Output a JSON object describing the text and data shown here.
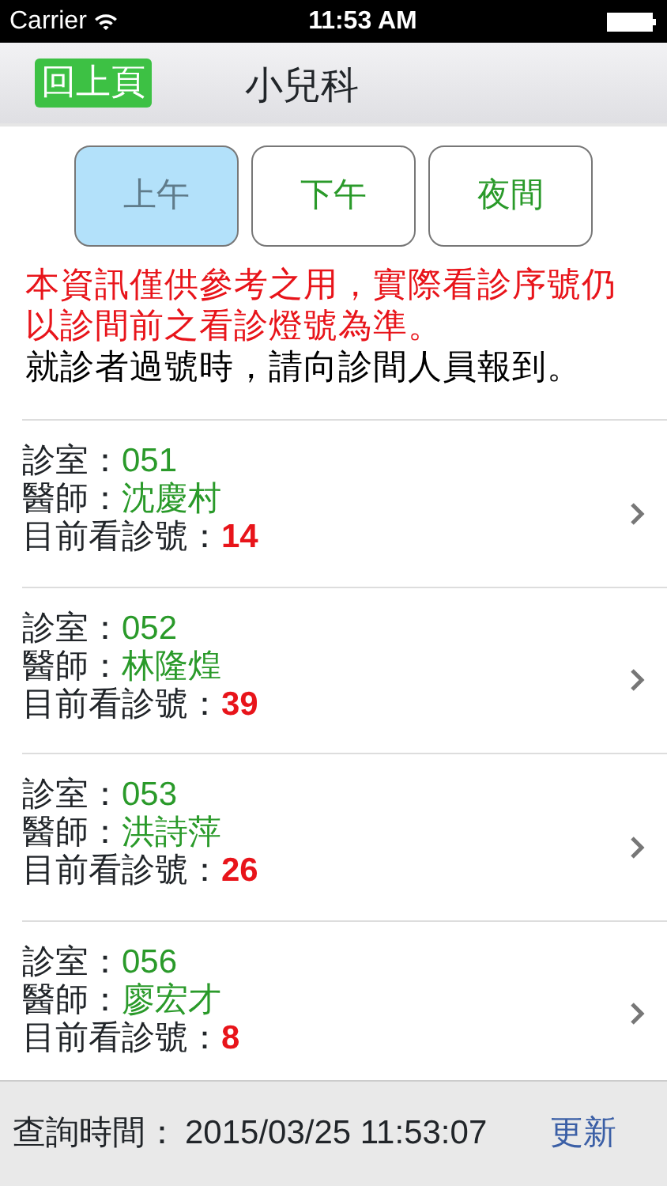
{
  "status_bar": {
    "carrier": "Carrier",
    "time": "11:53 AM"
  },
  "nav": {
    "back_button": "回上頁",
    "title": "小兒科"
  },
  "segments": [
    {
      "label": "上午",
      "selected": true
    },
    {
      "label": "下午",
      "selected": false
    },
    {
      "label": "夜間",
      "selected": false
    }
  ],
  "notice": {
    "warning": "本資訊僅供參考之用，實際看診序號仍以診間前之看診燈號為準。",
    "info": "就診者過號時，請向診間人員報到。"
  },
  "rooms": [
    {
      "room_label": "診室：",
      "room": "051",
      "doctor_label": "醫師：",
      "doctor": "沈慶村",
      "number_label": "目前看診號：",
      "number": "14"
    },
    {
      "room_label": "診室：",
      "room": "052",
      "doctor_label": "醫師：",
      "doctor": "林隆煌",
      "number_label": "目前看診號：",
      "number": "39"
    },
    {
      "room_label": "診室：",
      "room": "053",
      "doctor_label": "醫師：",
      "doctor": "洪詩萍",
      "number_label": "目前看診號：",
      "number": "26"
    },
    {
      "room_label": "診室：",
      "room": "056",
      "doctor_label": "醫師：",
      "doctor": "廖宏才",
      "number_label": "目前看診號：",
      "number": "8"
    }
  ],
  "footer": {
    "query_label": "查詢時間：",
    "query_time": "2015/03/25 11:53:07",
    "refresh": "更新"
  }
}
